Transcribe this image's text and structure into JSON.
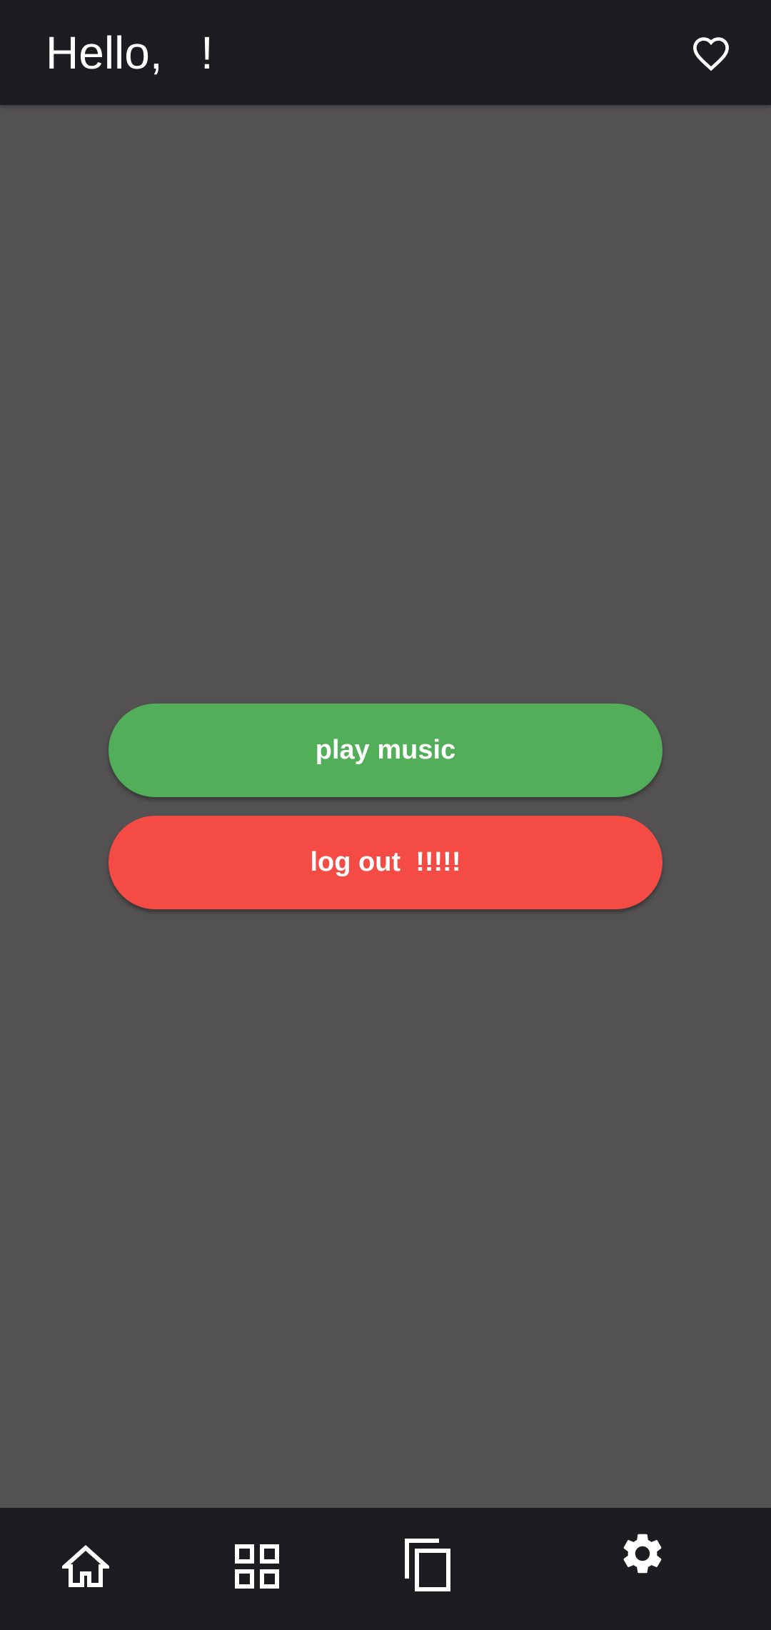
{
  "header": {
    "greeting": "Hello,   !",
    "favorite_icon": "heart-outline-icon"
  },
  "actions": {
    "play_label": "play music",
    "play_color": "#52ae58",
    "logout_label": "log out  !!!!!",
    "logout_color": "#f44c45"
  },
  "bottom_nav": {
    "items": [
      {
        "icon": "home-icon"
      },
      {
        "icon": "grid-icon"
      },
      {
        "icon": "copy-icon"
      },
      {
        "icon": "settings-icon"
      }
    ]
  },
  "colors": {
    "bar_background": "#1d1c21",
    "content_background": "#535152",
    "icon": "#ffffff"
  }
}
